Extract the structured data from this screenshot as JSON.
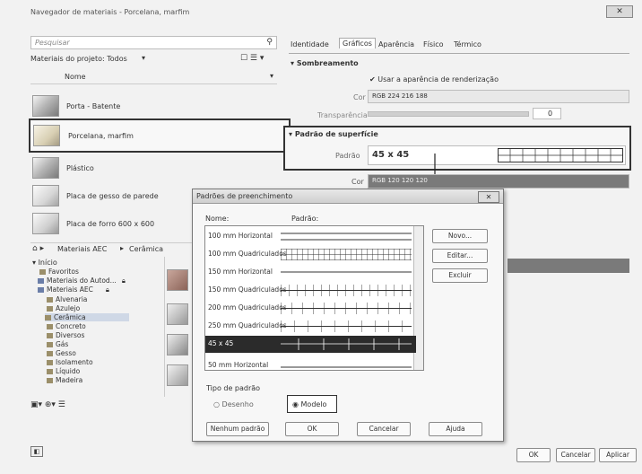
{
  "window": {
    "title": "Navegador de materiais - Porcelana, marfim"
  },
  "search": {
    "placeholder": "Pesquisar"
  },
  "filter": {
    "label": "Materiais do projeto: Todos"
  },
  "list_header": {
    "name": "Nome"
  },
  "materials": [
    {
      "label": "Porta - Batente"
    },
    {
      "label": "Porcelana, marfim"
    },
    {
      "label": "Plástico"
    },
    {
      "label": "Placa de gesso de parede"
    },
    {
      "label": "Placa de forro 600 x 600"
    }
  ],
  "library_bar": {
    "path1": "Materiais AEC",
    "path2": "Cerâmica"
  },
  "tree": {
    "root": "Início",
    "items": [
      "Favoritos",
      "Materiais do Autod...",
      "Materiais AEC",
      "Alvenaria",
      "Azulejo",
      "Cerâmica",
      "Concreto",
      "Diversos",
      "Gás",
      "Gesso",
      "Isolamento",
      "Líquido",
      "Madeira"
    ]
  },
  "tabs": [
    "Identidade",
    "Gráficos",
    "Aparência",
    "Físico",
    "Térmico"
  ],
  "shading": {
    "header": "Sombreamento",
    "checkbox_label": "Usar a aparência de renderização",
    "color_label": "Cor",
    "color_value": "RGB 224 216 188",
    "transparency_label": "Transparência",
    "transparency_value": "0"
  },
  "surface": {
    "header": "Padrão de superfície",
    "pattern_label": "Padrão",
    "pattern_value": "45 x 45",
    "color_label": "Cor",
    "color_value": "RGB 120 120 120"
  },
  "dialog": {
    "title": "Padrões de preenchimento",
    "col_name": "Nome:",
    "col_pattern": "Padrão:",
    "patterns": [
      {
        "name": "100 mm Horizontal"
      },
      {
        "name": "100 mm Quadriculados"
      },
      {
        "name": "150 mm Horizontal"
      },
      {
        "name": "150 mm Quadriculados"
      },
      {
        "name": "200 mm Quadriculados"
      },
      {
        "name": "250 mm Quadriculados"
      },
      {
        "name": "45 x 45"
      },
      {
        "name": "50 mm Horizontal"
      }
    ],
    "selected": "45 x 45",
    "new_label": "Novo...",
    "edit_label": "Editar...",
    "delete_label": "Excluir",
    "type_title": "Tipo de padrão",
    "radio_drafting": "Desenho",
    "radio_model": "Modelo",
    "no_pattern_label": "Nenhum padrão",
    "ok_label": "OK",
    "cancel_label": "Cancelar",
    "help_label": "Ajuda"
  },
  "footer": {
    "ok": "OK",
    "cancel": "Cancelar",
    "apply": "Aplicar"
  },
  "colors": {
    "accent_border": "#333333",
    "selected_row": "#2b2b2b",
    "header_fill": "#dcdcdc"
  }
}
